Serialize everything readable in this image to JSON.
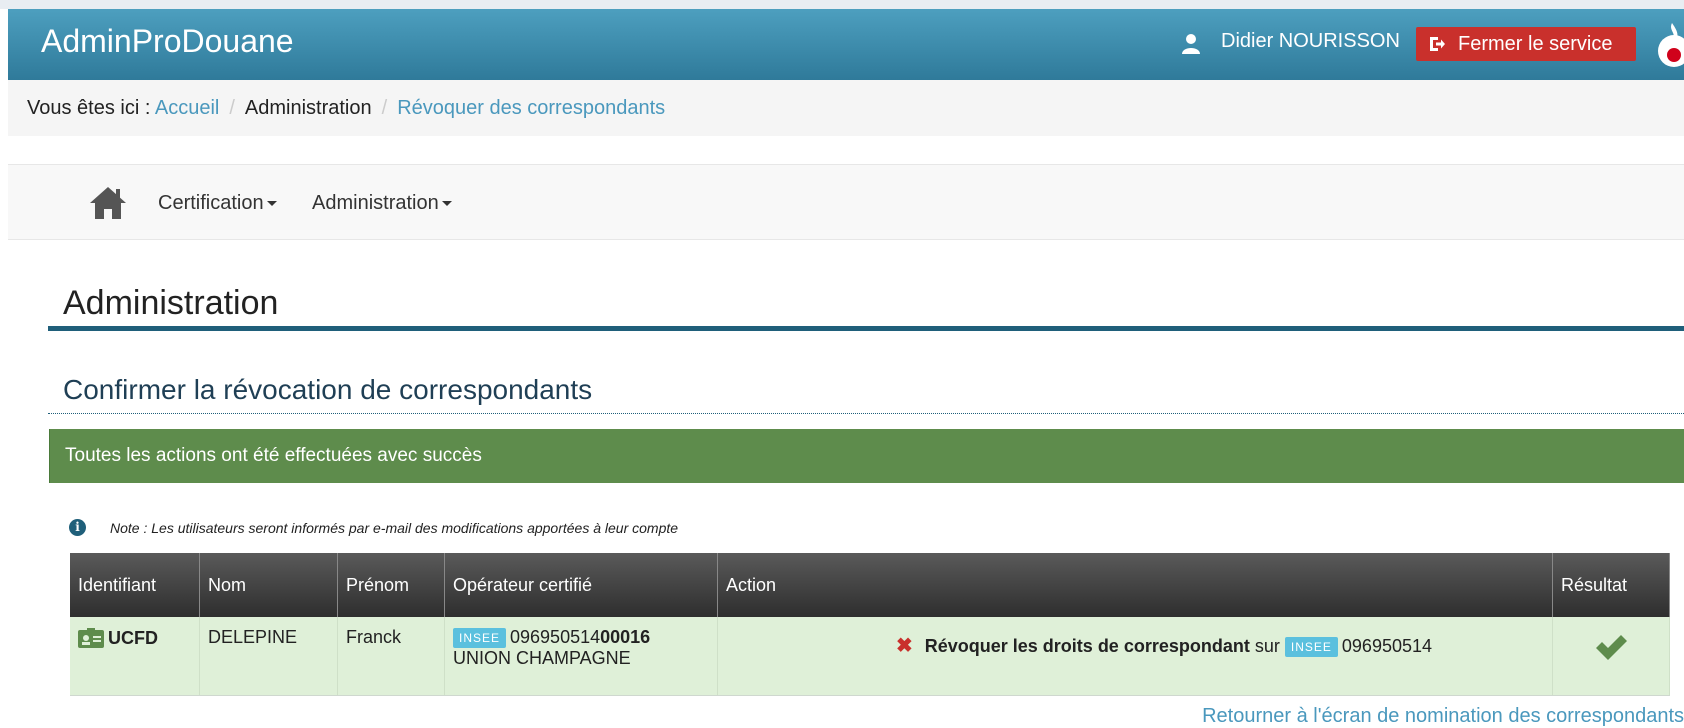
{
  "header": {
    "app_title": "AdminProDouane",
    "user_name": "Didier NOURISSON",
    "close_label": "Fermer le service"
  },
  "breadcrumb": {
    "prefix": "Vous êtes ici : ",
    "items": [
      "Accueil",
      "Administration",
      "Révoquer des correspondants"
    ]
  },
  "nav": {
    "items": [
      "Certification",
      "Administration"
    ]
  },
  "page": {
    "title": "Administration",
    "section_title": "Confirmer la révocation de correspondants",
    "alert": "Toutes les actions ont été effectuées avec succès",
    "note": "Note : Les utilisateurs seront informés par e-mail des modifications apportées à leur compte"
  },
  "table": {
    "headers": [
      "Identifiant",
      "Nom",
      "Prénom",
      "Opérateur certifié",
      "Action",
      "Résultat"
    ],
    "rows": [
      {
        "identifiant": "UCFD",
        "nom": "DELEPINE",
        "prenom": "Franck",
        "operateur_badge": "INSEE",
        "operateur_siren": "096950514",
        "operateur_suffix": "00016",
        "operateur_name": "UNION CHAMPAGNE",
        "action_bold": "Révoquer les droits de correspondant",
        "action_sur": "sur",
        "action_badge": "INSEE",
        "action_siren": "096950514",
        "resultat": "success"
      }
    ]
  },
  "footer": {
    "return_link": "Retourner à l'écran de nomination des correspondants"
  },
  "colors": {
    "header": "#3a8bad",
    "close_button": "#c9302c",
    "alert_success": "#5e8c4c",
    "row_success": "#dff0d8",
    "link": "#4a98bd"
  }
}
